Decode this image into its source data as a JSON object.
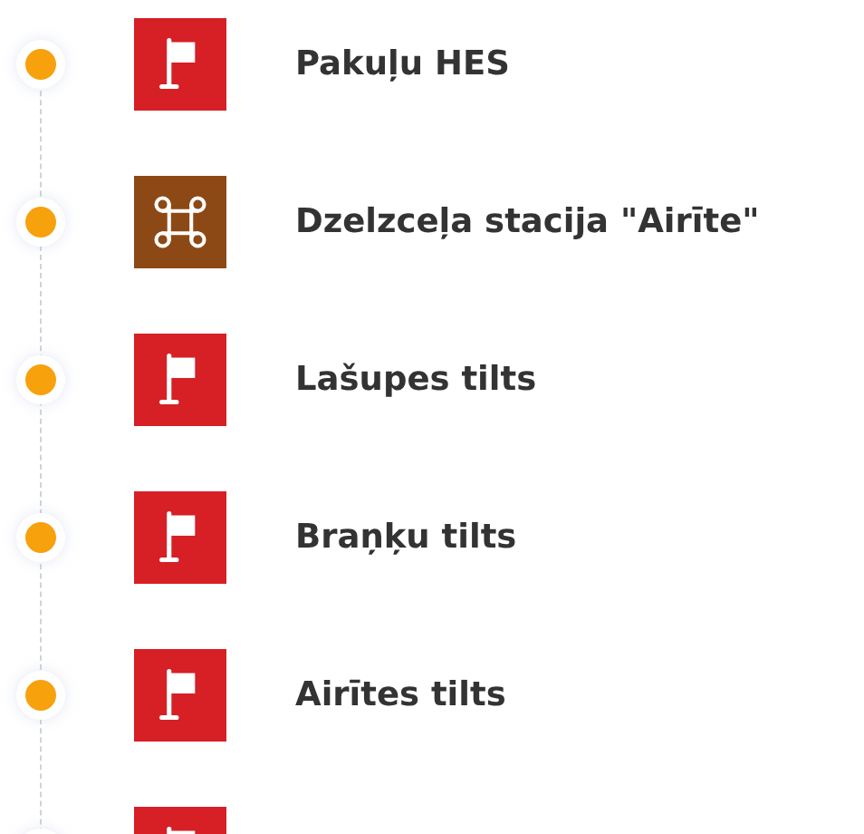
{
  "items": [
    {
      "kind": "flag",
      "label": "Pakuļu HES"
    },
    {
      "kind": "station",
      "label": "Dzelzceļa stacija \"Airīte\""
    },
    {
      "kind": "flag",
      "label": "Lašupes tilts"
    },
    {
      "kind": "flag",
      "label": "Braņķu tilts"
    },
    {
      "kind": "flag",
      "label": "Airītes tilts"
    },
    {
      "kind": "flag"
    }
  ]
}
